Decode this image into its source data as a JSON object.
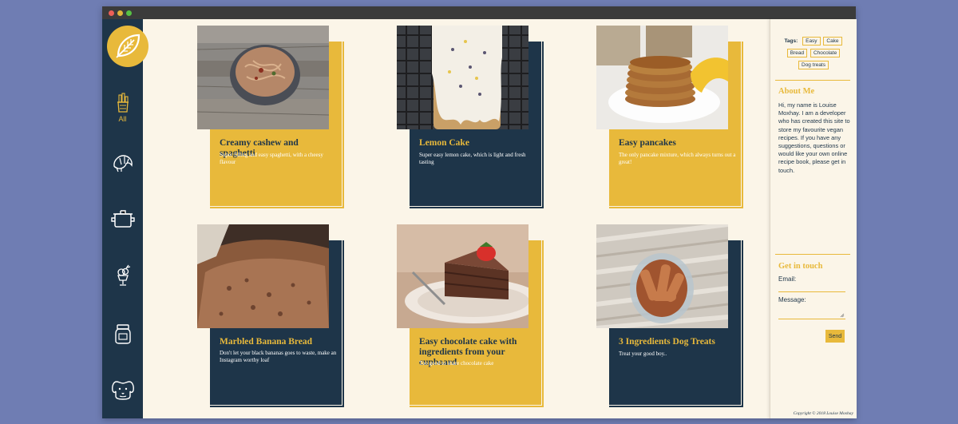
{
  "window": {
    "controls": [
      "close",
      "minimize",
      "maximize"
    ]
  },
  "sidebar": {
    "logo_icon": "leaf-icon",
    "items": [
      {
        "icon": "bread-basket-icon",
        "label": "All",
        "active": true
      },
      {
        "icon": "croissant-icon",
        "label": ""
      },
      {
        "icon": "cooking-pot-icon",
        "label": ""
      },
      {
        "icon": "ice-cream-cup-icon",
        "label": ""
      },
      {
        "icon": "jar-icon",
        "label": ""
      },
      {
        "icon": "dog-icon",
        "label": ""
      }
    ]
  },
  "recipes": [
    {
      "title": "Creamy cashew and spaghetti",
      "description": "Super filling and easy spaghetti, with a cheesy flavour",
      "theme": "yellow",
      "photo": "pasta-bowl"
    },
    {
      "title": "Lemon Cake",
      "description": "Super easy lemon cake, which is light and fresh tasting",
      "theme": "navy",
      "photo": "lemon-cake"
    },
    {
      "title": "Easy pancakes",
      "description": "The only pancake mixture, which always turns out a great!",
      "theme": "yellow",
      "photo": "pancakes"
    },
    {
      "title": "Marbled Banana Bread",
      "description": "Don't let your black bananas goes to waste, make an Instagram worthy loaf",
      "theme": "navy",
      "photo": "banana-bread"
    },
    {
      "title": "Easy chocolate cake with ingredients from your cupboard",
      "description": "Too good to share chocolate cake",
      "theme": "yellow",
      "photo": "chocolate-cake"
    },
    {
      "title": "3 Ingredients Dog Treats",
      "description": "Treat your good boy..",
      "theme": "navy",
      "photo": "dog-treats"
    }
  ],
  "tags": {
    "label": "Tags:",
    "items": [
      "Easy",
      "Cake",
      "Bread",
      "Chocolate",
      "Dog treats"
    ]
  },
  "about": {
    "title": "About Me",
    "text": "Hi, my name is Louise Moxhay. I am a developer who has created this site to store my favourite vegan recipes. If you have any suggestions, questions or would like your own online recipe book, please get in touch."
  },
  "contact": {
    "title": "Get in touch",
    "email_label": "Email:",
    "message_label": "Message:",
    "send_label": "Send"
  },
  "footer": {
    "copyright": "Copyright © 2018 Louise Moxhay"
  },
  "colors": {
    "navy": "#1e3549",
    "yellow": "#e8b93b",
    "cream": "#fbf5e8",
    "background": "#6f7db3"
  }
}
